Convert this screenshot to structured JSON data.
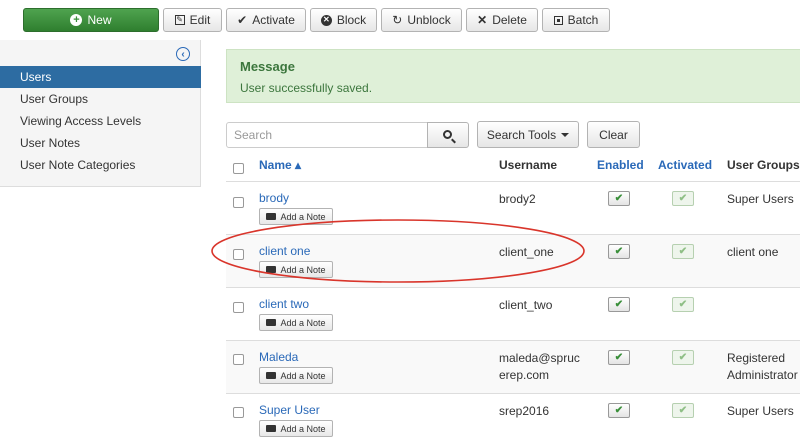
{
  "toolbar": {
    "new_label": "New",
    "edit_label": "Edit",
    "activate_label": "Activate",
    "block_label": "Block",
    "unblock_label": "Unblock",
    "delete_label": "Delete",
    "batch_label": "Batch"
  },
  "sidebar": {
    "items": [
      {
        "label": "Users",
        "active": true
      },
      {
        "label": "User Groups"
      },
      {
        "label": "Viewing Access Levels"
      },
      {
        "label": "User Notes"
      },
      {
        "label": "User Note Categories"
      }
    ]
  },
  "message": {
    "title": "Message",
    "text": "User successfully saved."
  },
  "search": {
    "placeholder": "Search",
    "tools_label": "Search Tools",
    "clear_label": "Clear"
  },
  "table": {
    "headers": {
      "name": "Name",
      "username": "Username",
      "enabled": "Enabled",
      "activated": "Activated",
      "groups": "User Groups"
    },
    "sort_indicator": "▴",
    "add_note_label": "Add a Note",
    "rows": [
      {
        "name": "brody",
        "username": "brody2",
        "groups": "Super Users",
        "enabled": true,
        "activated": true
      },
      {
        "name": "client one",
        "username": "client_one",
        "groups": "client one",
        "enabled": true,
        "activated": true
      },
      {
        "name": "client two",
        "username": "client_two",
        "groups": "",
        "enabled": true,
        "activated": true
      },
      {
        "name": "Maleda",
        "username_lines": [
          "maleda@spruc",
          "erep.com"
        ],
        "groups_lines": [
          "Registered",
          "Administrator"
        ],
        "enabled": true,
        "activated": true
      },
      {
        "name": "Super User",
        "username": "srep2016",
        "groups": "Super Users",
        "enabled": true,
        "activated": true
      }
    ]
  },
  "colors": {
    "new_button": "#3a8f3a",
    "sidebar_active": "#2d6ca2",
    "link": "#2a69b8",
    "message_bg": "#dff0d8",
    "annotation": "#d9352b"
  },
  "icons": {
    "new": "plus-circle-icon",
    "edit": "edit-icon",
    "activate": "check-icon",
    "block": "block-icon",
    "unblock": "refresh-icon",
    "delete": "x-icon",
    "batch": "batch-icon",
    "collapse": "collapse-left-icon",
    "search": "magnifier-icon",
    "note": "note-icon",
    "enabled": "check-icon"
  }
}
